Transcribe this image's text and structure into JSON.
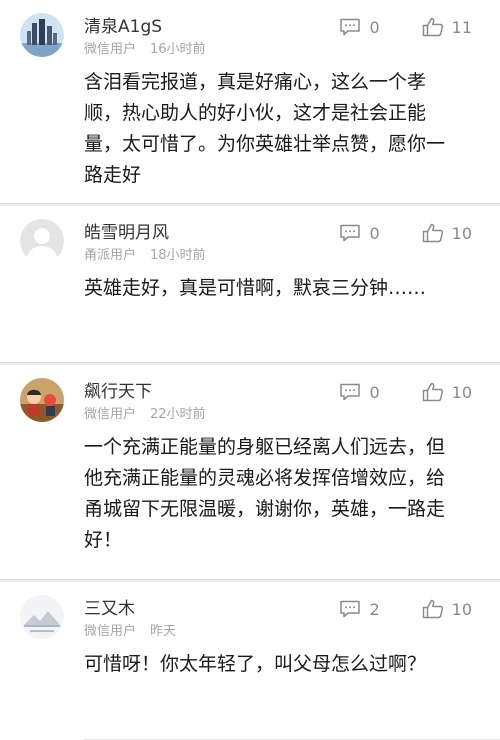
{
  "comments": [
    {
      "name": "清泉A1gS",
      "source": "微信用户",
      "time": "16小时前",
      "replies": "0",
      "likes": "11",
      "text": "含泪看完报道，真是好痛心，这么一个孝顺，热心助人的好小伙，这才是社会正能量，太可惜了。为你英雄壮举点赞，愿你一路走好",
      "avatar_icon": "city-skyline-avatar"
    },
    {
      "name": "皓雪明月风",
      "source": "甬派用户",
      "time": "18小时前",
      "replies": "0",
      "likes": "10",
      "text": "英雄走好，真是可惜啊，默哀三分钟……",
      "avatar_icon": "default-user-avatar"
    },
    {
      "name": "飙行天下",
      "source": "微信用户",
      "time": "22小时前",
      "replies": "0",
      "likes": "10",
      "text": "一个充满正能量的身躯已经离人们远去，但他充满正能量的灵魂必将发挥倍增效应，给甬城留下无限温暖，谢谢你，英雄，一路走好！",
      "avatar_icon": "cartoon-avatar"
    },
    {
      "name": "三又木",
      "source": "微信用户",
      "time": "昨天",
      "replies": "2",
      "likes": "10",
      "text": "可惜呀！你太年轻了，叫父母怎么过啊？",
      "avatar_icon": "landscape-avatar"
    }
  ],
  "colors": {
    "name": "#333333",
    "meta": "#a5a5a5",
    "icon": "#8a8a8a",
    "separator": "#ececec"
  }
}
